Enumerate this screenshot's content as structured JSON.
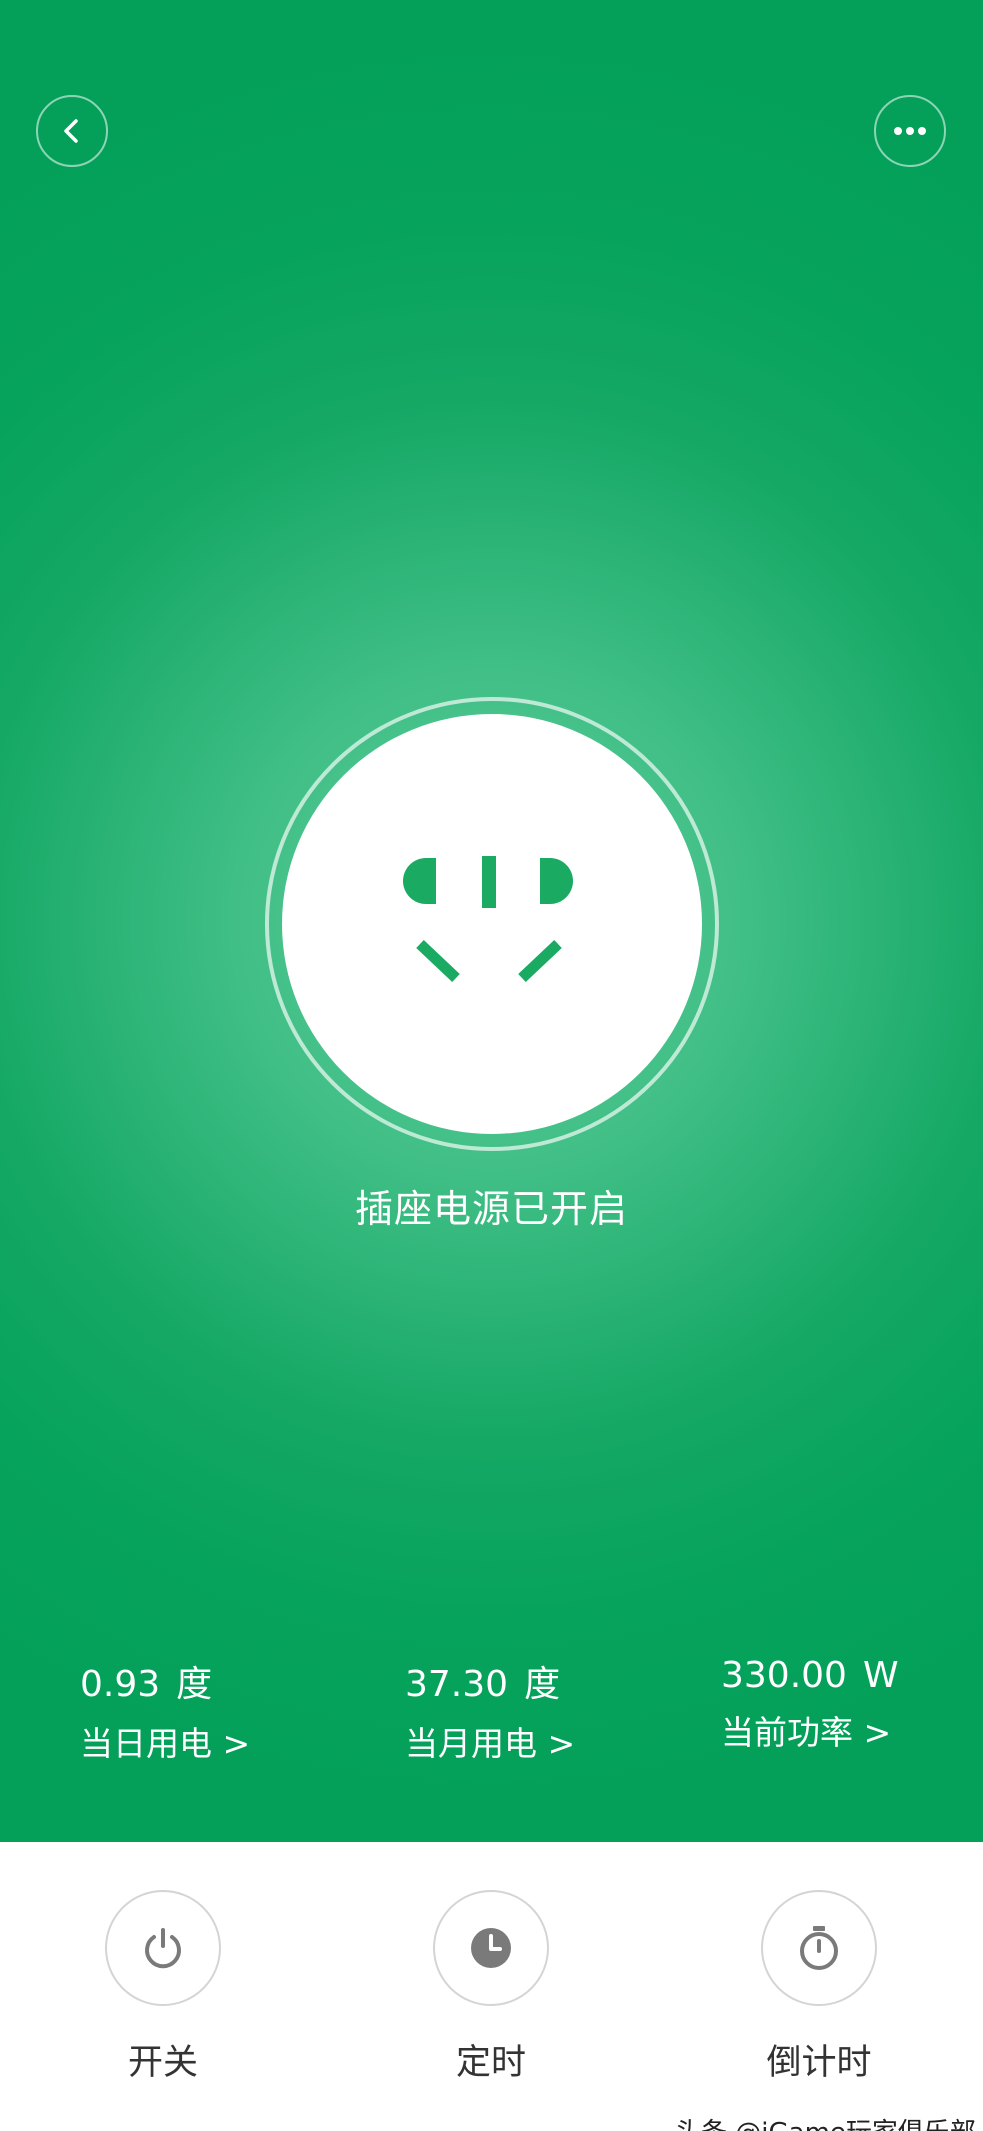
{
  "header": {
    "back_icon": "chevron-left-icon",
    "more_icon": "more-horizontal-icon"
  },
  "device": {
    "icon": "power-socket-icon",
    "status": "插座电源已开启"
  },
  "stats": [
    {
      "value": "0.93",
      "unit": "度",
      "label": "当日用电 >"
    },
    {
      "value": "37.30",
      "unit": "度",
      "label": "当月用电 >"
    },
    {
      "value": "330.00",
      "unit": "W",
      "label": "当前功率 >"
    }
  ],
  "controls": [
    {
      "label": "开关",
      "icon": "power-icon"
    },
    {
      "label": "定时",
      "icon": "clock-icon"
    },
    {
      "label": "倒计时",
      "icon": "stopwatch-icon"
    }
  ],
  "watermark": "头条 @iGame玩家俱乐部",
  "colors": {
    "accent_green": "#06a35c",
    "socket_green": "#1aaa62",
    "icon_gray": "#7a7a7a"
  }
}
